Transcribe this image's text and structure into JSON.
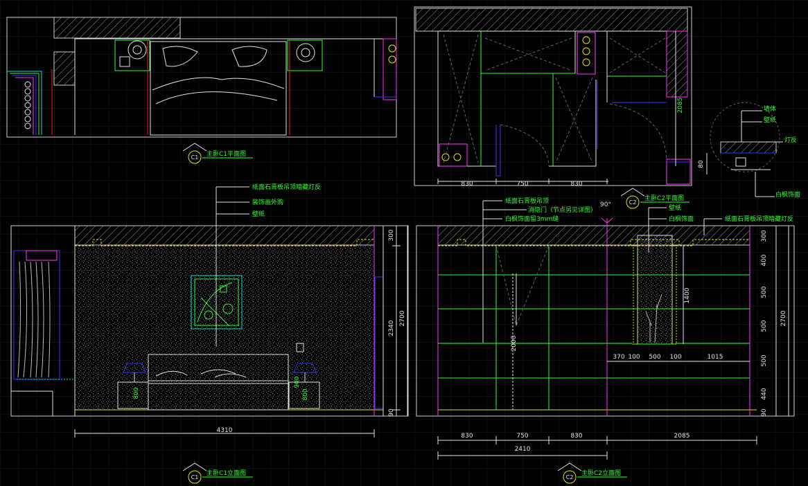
{
  "colors": {
    "background": "#000000",
    "grid": "#1c1c1c",
    "line_white": "#e6e6e6",
    "line_green": "#33ff33",
    "line_magenta": "#ff33ff",
    "line_yellow": "#e6e600",
    "line_red": "#ff2020",
    "line_cyan": "#00e5e5",
    "line_blue": "#3333ff",
    "text_green": "#33ff33"
  },
  "titles": {
    "c1_plan": {
      "mark": "C1",
      "label": "主卧C1平面图"
    },
    "c2_plan": {
      "mark": "C2",
      "label": "主卧C2平面图"
    },
    "c1_elev": {
      "mark": "C1",
      "label": "主卧C1立面图"
    },
    "c2_elev": {
      "mark": "C2",
      "label": "主卧C2立面图"
    }
  },
  "c1_notes": [
    "纸面石膏板吊顶暗藏灯反",
    "装饰画外购",
    "壁纸"
  ],
  "c2_notes_left": [
    "纸面石膏板吊顶",
    "消隐门（节点另见详图）",
    "白枫饰面留3mm缝"
  ],
  "c2_notes_mid": [
    "壁纸",
    "白枫饰面"
  ],
  "c2_notes_right": "纸面石膏板吊顶暗藏灯反",
  "door_angle": "90°",
  "detail_notes": [
    "墙体",
    "壁纸",
    "灯反",
    "白枫饰面"
  ],
  "detail_dim": "80",
  "plan_c2_dims": [
    "830",
    "750",
    "830"
  ],
  "plan_c2_height": "2085",
  "c1_dims": {
    "total": "4310",
    "h300": "300",
    "h2340": "2340",
    "h2700": "2700",
    "h90": "90",
    "h900": "900",
    "h800": "800"
  },
  "c2_bottom_dims": [
    "830",
    "750",
    "830",
    "2085"
  ],
  "c2_dim_2410": "2410",
  "c2_dim_2000": "2000",
  "c2_niche_dims": [
    "370",
    "100",
    "500",
    "100",
    "1015"
  ],
  "c2_niche_height": "1400",
  "c2_right_dims": [
    "300",
    "400",
    "500",
    "500",
    "500",
    "440",
    "90"
  ],
  "c2_dim_2700": "2700"
}
